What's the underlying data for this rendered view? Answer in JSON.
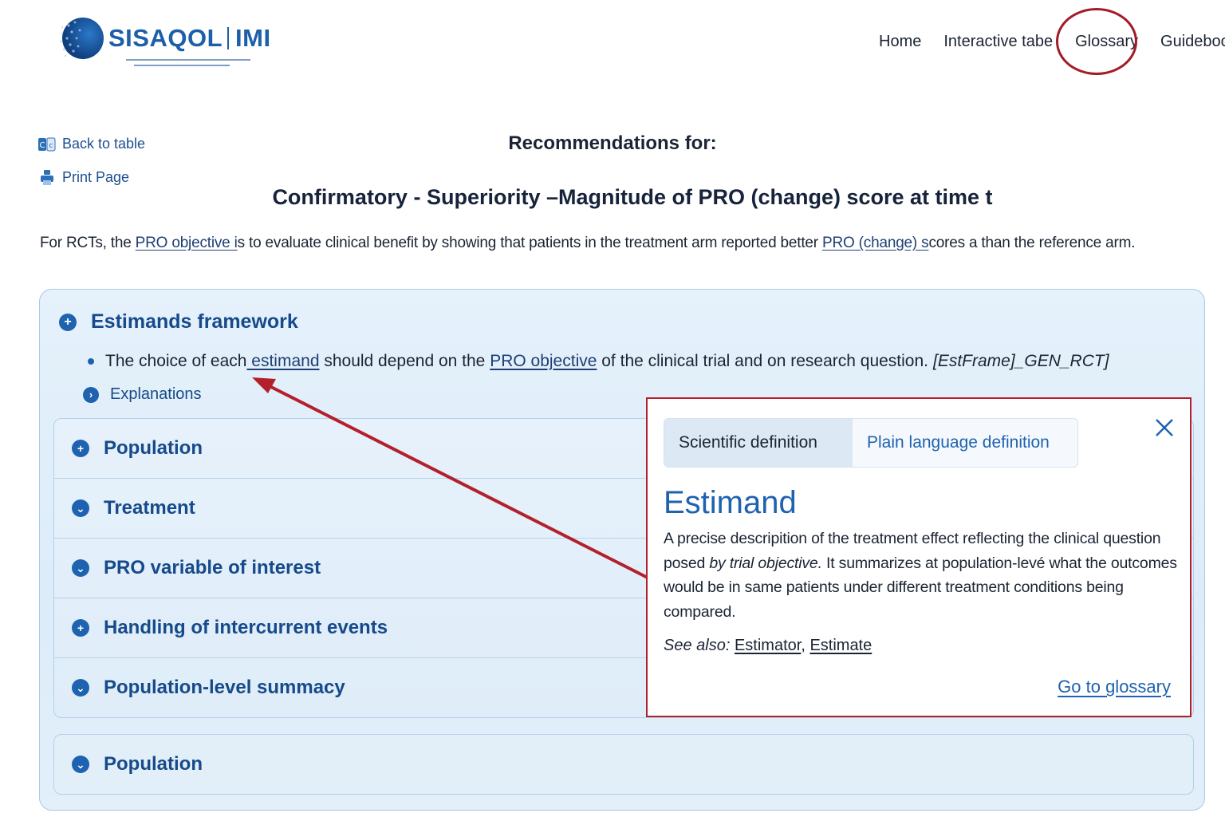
{
  "header": {
    "logo_name_a": "SISAQOL",
    "logo_name_b": "IMI",
    "nav": [
      {
        "label": "Home"
      },
      {
        "label": "Interactive tabe"
      },
      {
        "label": "Glossary"
      },
      {
        "label": "Guideboo"
      }
    ]
  },
  "side": {
    "back_label": "Back to table",
    "print_label": "Print Page"
  },
  "page": {
    "rec_for": "Recommendations for:",
    "title": "Confirmatory - Superiority –Magnitude of PRO (change) score at time t",
    "intro_a": "For RCTs, the ",
    "intro_link1": "PRO objective i",
    "intro_b": "s to evaluate clinical benefit by showing that patients in the treatment arm reported better ",
    "intro_link2": "PRO (change) s",
    "intro_c": "cores a than the reference arm."
  },
  "panel": {
    "section_title": "Estimands framework",
    "bullet_a": "The choice of each",
    "bullet_link1": " estimand",
    "bullet_b": " should depend on the ",
    "bullet_link2": "PRO objective",
    "bullet_c": " of the clinical trial and on research question.",
    "bullet_code": "[EstFrame]_GEN_RCT]",
    "explanations": "Explanations",
    "rows": [
      {
        "label": "Population"
      },
      {
        "label": "Treatment"
      },
      {
        "label": "PRO variable of interest"
      },
      {
        "label": "Handling of intercurrent events"
      },
      {
        "label": "Population-level summacy"
      }
    ],
    "bottom_label": "Population"
  },
  "popup": {
    "tab_scientific": "Scientific definition",
    "tab_plain": "Plain language definition",
    "term": "Estimand",
    "def_a": "A precise descripition of the treatment effect reflecting the clinical question posed ",
    "def_italic": "by trial objective.",
    "def_b": " It summarizes at population-levé what the outcomes would be in same patients under different treatment conditions being compared.",
    "see_also_label": "See also:",
    "see_also_1": "Estimator",
    "see_also_sep": ", ",
    "see_also_2": "Estimate",
    "goto": "Go to glossary"
  },
  "colors": {
    "accent": "#1e62b0",
    "annotation_red": "#b3202c",
    "panel_bg": "#dcecf9"
  }
}
